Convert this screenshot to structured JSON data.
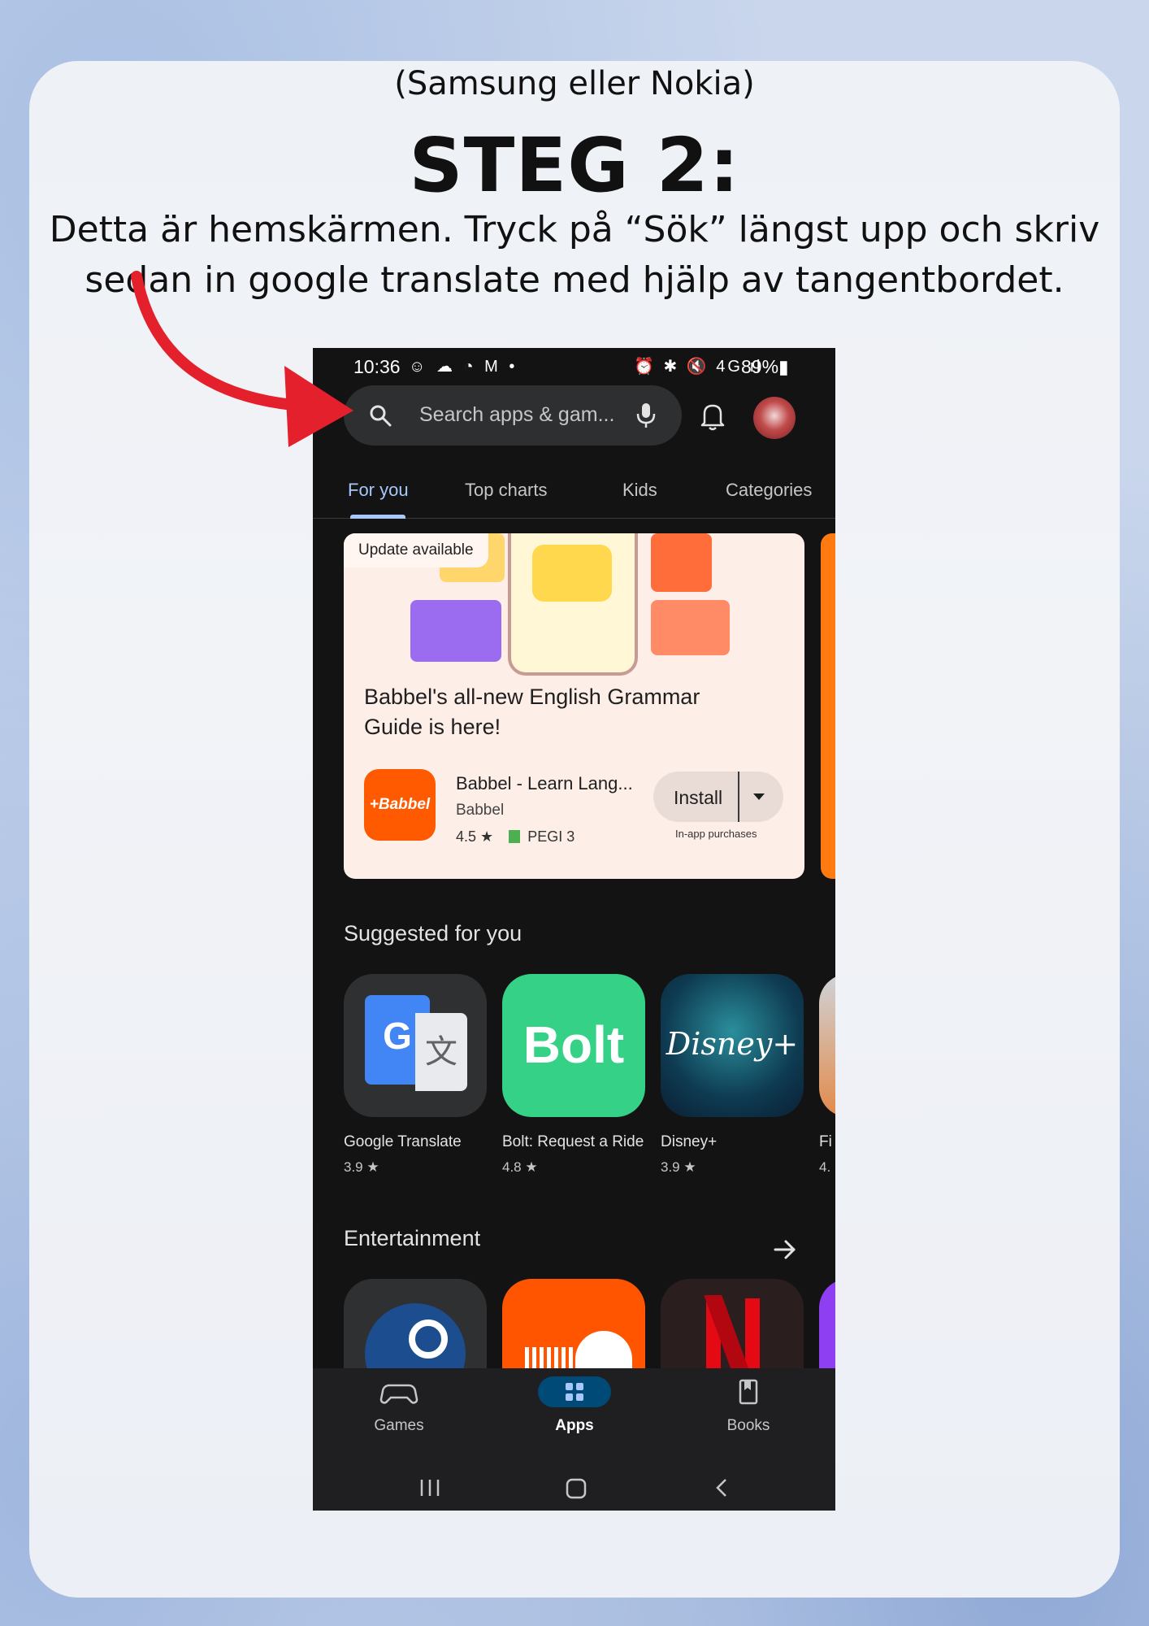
{
  "colors": {
    "accent_blue": "#a8c7fa",
    "arrow_red": "#e3202c",
    "babbel_orange": "#ff5a00",
    "bolt_green": "#34d186",
    "phone_bg": "#131314"
  },
  "slide": {
    "subtitle": "(Samsung eller Nokia)",
    "heading": "STEG 2:",
    "instructions": "Detta är hemskärmen. Tryck på “Sök” längst upp och skriv sedan in google translate med hjälp av tangentbordet."
  },
  "status_bar": {
    "time": "10:36",
    "battery": "89%",
    "left_icons": "snapchat-icon, weather-icon, sync-icon, gmail-icon, dot",
    "right_icons": "alarm-icon, bluetooth-icon, mute-icon, 4g-icon, signal-icon"
  },
  "search": {
    "placeholder": "Search apps & gam..."
  },
  "tabs": [
    {
      "label": "For you",
      "active": true
    },
    {
      "label": "Top charts",
      "active": false
    },
    {
      "label": "Kids",
      "active": false
    },
    {
      "label": "Categories",
      "active": false
    }
  ],
  "promo": {
    "badge": "Update available",
    "title": "Babbel's all-new English Grammar Guide is here!",
    "icon_text": "+Babbel",
    "app_name": "Babbel - Learn Lang...",
    "developer": "Babbel",
    "rating": "4.5 ★",
    "pegi": "PEGI 3",
    "install_label": "Install",
    "iap_note": "In-app purchases"
  },
  "suggested": {
    "title": "Suggested for you",
    "apps": [
      {
        "name": "Google Translate",
        "rating": "3.9 ★"
      },
      {
        "name": "Bolt: Request a Ride",
        "rating": "4.8 ★",
        "icon_text": "Bolt"
      },
      {
        "name": "Disney+",
        "rating": "3.9 ★",
        "icon_text": "Disney+"
      },
      {
        "name": "Fi",
        "rating": "4."
      }
    ]
  },
  "entertainment": {
    "title": "Entertainment",
    "apps": [
      "steam-icon",
      "soundcloud-icon",
      "netflix-icon",
      "purple-app-icon"
    ]
  },
  "bottom_nav": [
    {
      "label": "Games",
      "active": false
    },
    {
      "label": "Apps",
      "active": true
    },
    {
      "label": "Books",
      "active": false
    }
  ]
}
